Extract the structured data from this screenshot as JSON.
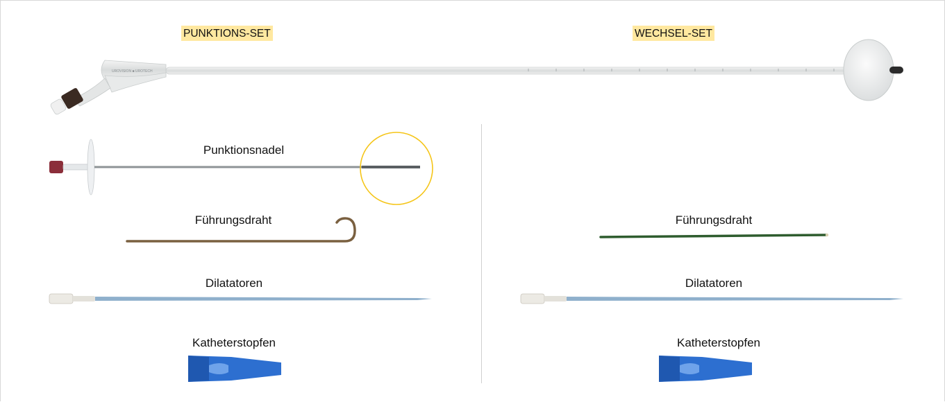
{
  "sets": {
    "left": {
      "title": "PUNKTIONS-SET"
    },
    "right": {
      "title": "WECHSEL-SET"
    }
  },
  "catheter": {
    "brand_print": "UROVISION ■ UROTECH"
  },
  "left_items": {
    "needle": "Punktionsnadel",
    "guidewire": "Führungsdraht",
    "dilator": "Dilatatoren",
    "stopper": "Katheterstopfen"
  },
  "right_items": {
    "guidewire": "Führungsdraht",
    "dilator": "Dilatatoren",
    "stopper": "Katheterstopfen"
  },
  "colors": {
    "highlight": "#ffe8a0",
    "needle_circle": "#f5c518",
    "stopper_blue": "#2d6fd0",
    "dilator_blue": "#8fb0cc",
    "left_wire": "#7a6040",
    "right_wire": "#2e5c2e"
  }
}
